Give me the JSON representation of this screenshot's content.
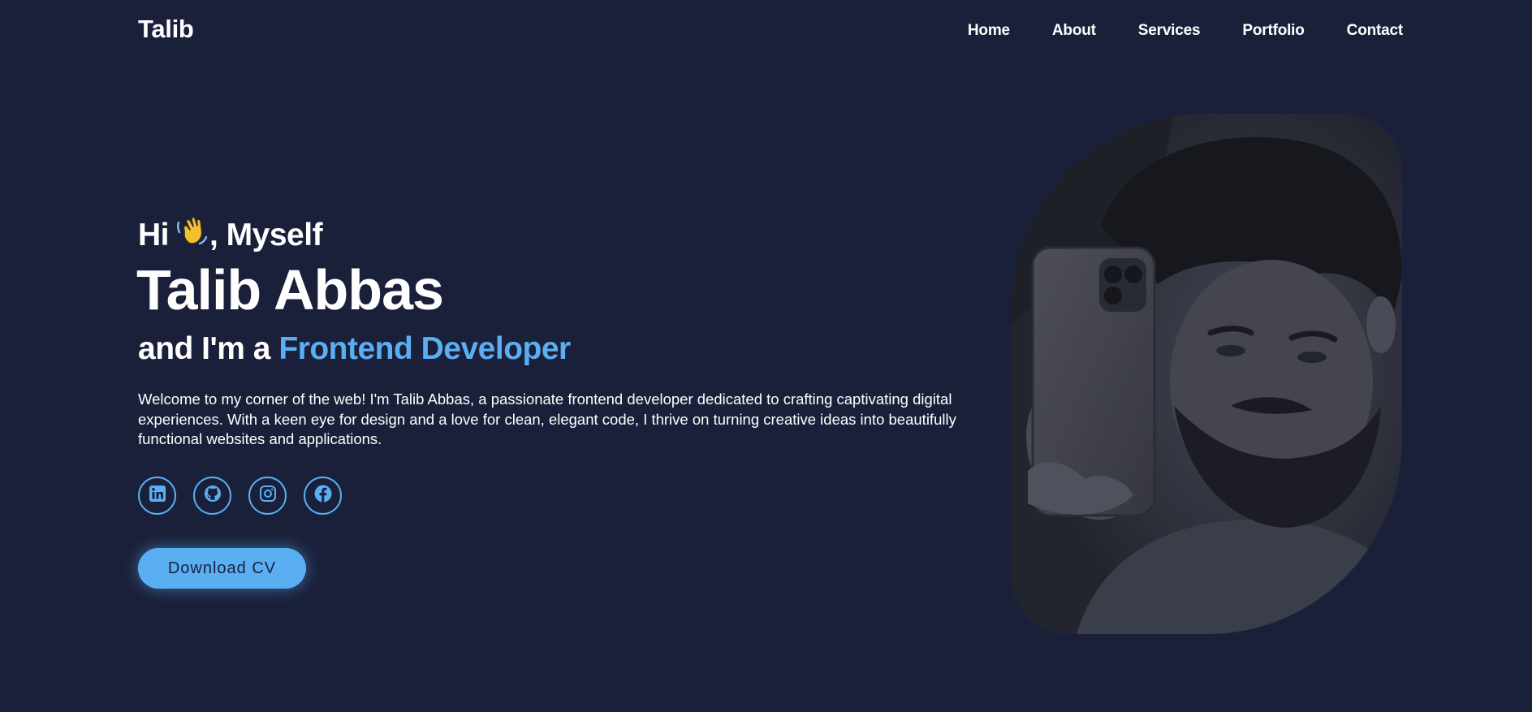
{
  "header": {
    "logo": "Talib",
    "nav": [
      "Home",
      "About",
      "Services",
      "Portfolio",
      "Contact"
    ]
  },
  "hero": {
    "greeting_prefix": "Hi",
    "greeting_emoji": "👋",
    "greeting_suffix": ", Myself",
    "name": "Talib Abbas",
    "role_prefix": "and I'm a",
    "role_highlight": "Frontend Developer",
    "intro": "Welcome to my corner of the web! I'm Talib Abbas, a passionate frontend developer dedicated to crafting captivating digital experiences. With a keen eye for design and a love for clean, elegant code, I thrive on turning creative ideas into beautifully functional websites and applications.",
    "cv_button": "Download CV"
  },
  "socials": [
    {
      "icon": "linkedin-icon"
    },
    {
      "icon": "github-icon"
    },
    {
      "icon": "instagram-icon"
    },
    {
      "icon": "facebook-icon"
    }
  ],
  "colors": {
    "background": "#1b203a",
    "accent": "#5aaef2",
    "text": "#ffffff"
  }
}
